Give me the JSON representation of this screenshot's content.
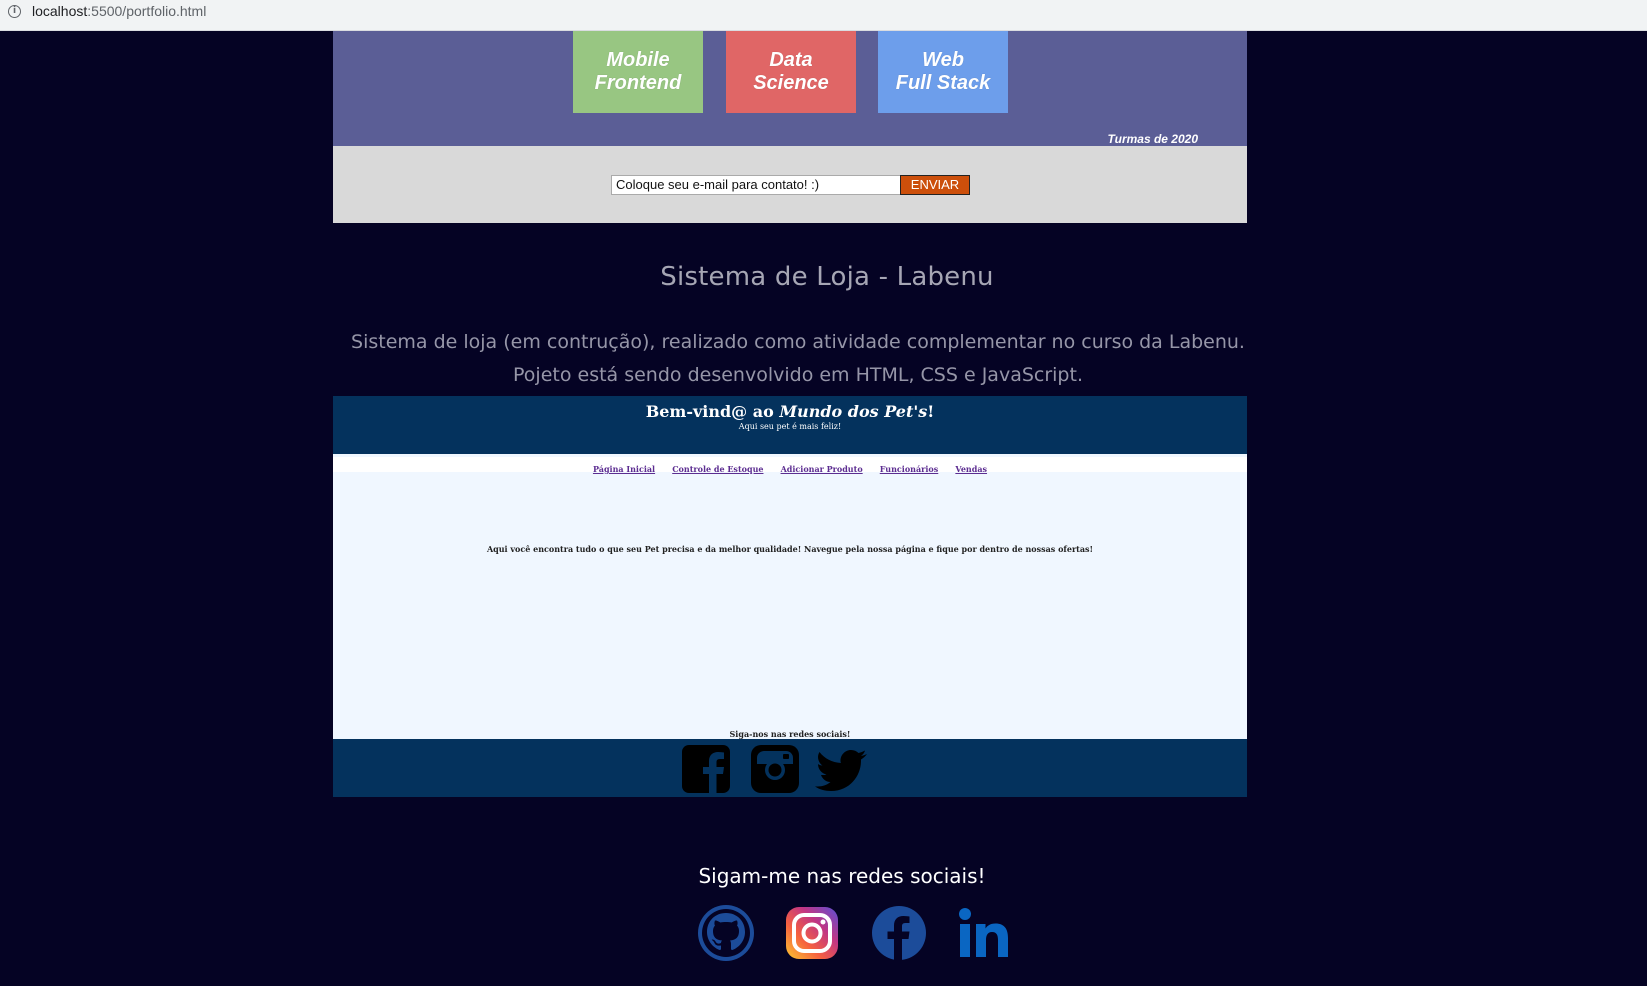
{
  "browser": {
    "url_host": "localhost",
    "url_path": ":5500/portfolio.html"
  },
  "labenu": {
    "courses": [
      {
        "line1": "Mobile",
        "line2": "Frontend",
        "color": "#98c682"
      },
      {
        "line1": "Data",
        "line2": "Science",
        "color": "#e06666"
      },
      {
        "line1": "Web",
        "line2": "Full Stack",
        "color": "#6d9eeb"
      }
    ],
    "turmas": "Turmas de 2020",
    "email_placeholder": "Coloque seu e-mail para contato! :)",
    "send_label": "ENVIAR"
  },
  "project": {
    "title": "Sistema de Loja - Labenu",
    "desc_line1": "Sistema de loja (em contrução), realizado como atividade complementar no curso da Labenu.",
    "desc_line2": "Pojeto está sendo desenvolvido em HTML, CSS e JavaScript."
  },
  "petshop": {
    "title_prefix": "Bem-vind@ ao ",
    "title_italic": "Mundo dos Pet's",
    "title_suffix": "!",
    "subtitle": "Aqui seu pet é mais feliz!",
    "nav": [
      "Página Inicial",
      "Controle de Estoque",
      "Adicionar Produto",
      "Funcionários",
      "Vendas"
    ],
    "main_text": "Aqui você encontra tudo o que seu Pet precisa e da melhor qualidade! Navegue pela nossa página e fique por dentro de nossas ofertas!",
    "follow_text": "Siga-nos nas redes sociais!",
    "social_icons": [
      "facebook-icon",
      "instagram-icon",
      "twitter-icon"
    ]
  },
  "footer": {
    "follow_text": "Sigam-me nas redes sociais!",
    "social_icons": [
      "github-icon",
      "instagram-icon",
      "facebook-icon",
      "linkedin-icon"
    ]
  }
}
